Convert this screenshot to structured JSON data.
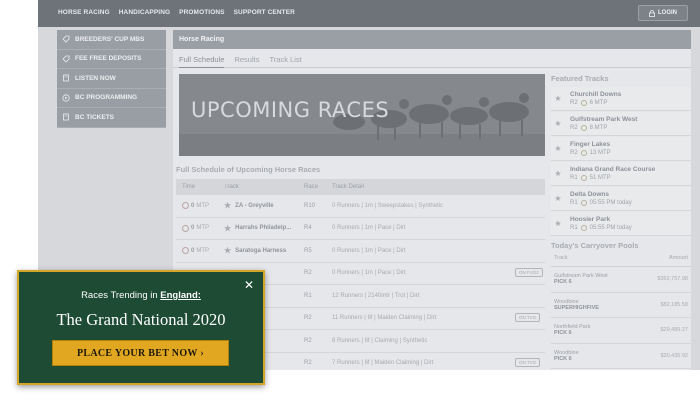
{
  "nav": {
    "links": [
      "HORSE RACING",
      "HANDICAPPING",
      "PROMOTIONS",
      "SUPPORT CENTER"
    ],
    "login_label": "LOGIN"
  },
  "sidebar": {
    "items": [
      {
        "label": "BREEDERS' CUP MBS",
        "icon": "tag-icon"
      },
      {
        "label": "FEE FREE DEPOSITS",
        "icon": "tag-icon"
      },
      {
        "label": "LISTEN NOW",
        "icon": "document-icon"
      },
      {
        "label": "BC PROGRAMMING",
        "icon": "play-icon"
      },
      {
        "label": "BC TICKETS",
        "icon": "document-icon"
      }
    ]
  },
  "main": {
    "title": "Horse Racing",
    "tabs": [
      "Full Schedule",
      "Results",
      "Track List"
    ],
    "banner_text": "UPCOMING RACES",
    "schedule_title": "Full Schedule of Upcoming Horse Races",
    "columns": [
      "Time",
      "Track",
      "Race",
      "Track Detail"
    ],
    "rows": [
      {
        "time": "0",
        "unit": "MTP",
        "track": "ZA - Greyville",
        "race": "R10",
        "detail": "0 Runners | 1m | Sweepstakes | Synthetic",
        "tvg": ""
      },
      {
        "time": "0",
        "unit": "MTP",
        "track": "Harrahs Philadelp...",
        "race": "R4",
        "detail": "0 Runners | 1m | Pace | Dirt",
        "tvg": ""
      },
      {
        "time": "0",
        "unit": "MTP",
        "track": "Saratoga Harness",
        "race": "R5",
        "detail": "0 Runners | 1m | Pace | Dirt",
        "tvg": ""
      },
      {
        "time": "",
        "unit": "",
        "track": "ows",
        "race": "R2",
        "detail": "0 Runners | 1m | Pace | Dirt",
        "tvg": "ON FVG2"
      },
      {
        "time": "",
        "unit": "",
        "track": "gsaker",
        "race": "R1",
        "detail": "12 Runners | 2140mtr | Trot | Dirt",
        "tvg": ""
      },
      {
        "time": "",
        "unit": "",
        "track": "ll Downs",
        "race": "R2",
        "detail": "11 Runners | 6f | Maiden Claiming | Dirt",
        "tvg": "ON TVG"
      },
      {
        "time": "",
        "unit": "",
        "track": "alk",
        "race": "R2",
        "detail": "8 Runners | 6f | Claiming | Synthetic",
        "tvg": ""
      },
      {
        "time": "",
        "unit": "",
        "track": "am Park ...",
        "race": "R2",
        "detail": "7 Runners | 6f | Maiden Claiming | Dirt",
        "tvg": "ON TVG"
      }
    ]
  },
  "featured": {
    "title": "Featured Tracks",
    "items": [
      {
        "name": "Churchill Downs",
        "race": "R2",
        "mtp": "6 MTP"
      },
      {
        "name": "Gulfstream Park West",
        "race": "R2",
        "mtp": "8 MTP"
      },
      {
        "name": "Finger Lakes",
        "race": "R2",
        "mtp": "13 MTP"
      },
      {
        "name": "Indiana Grand Race Course",
        "race": "R1",
        "mtp": "51 MTP"
      },
      {
        "name": "Delta Downs",
        "race": "R1",
        "mtp": "05:55 PM today"
      },
      {
        "name": "Hoosier Park",
        "race": "R1",
        "mtp": "05:55 PM today"
      }
    ]
  },
  "carryover": {
    "title": "Today's Carryover Pools",
    "col_track": "Track",
    "col_amount": "Amount",
    "rows": [
      {
        "track": "Gulfstream Park West",
        "pool": "PICK 6",
        "amount": "$362,757.98"
      },
      {
        "track": "Woodbine",
        "pool": "SUPERHIGHFIVE",
        "amount": "$82,185.58"
      },
      {
        "track": "Northfield Park",
        "pool": "PICK 6",
        "amount": "$29,489.27"
      },
      {
        "track": "Woodbine",
        "pool": "PICK 6",
        "amount": "$20,435.92"
      }
    ]
  },
  "popup": {
    "trend_prefix": "Races Trending in",
    "trend_place": "England:",
    "headline": "The Grand National 2020",
    "cta": "PLACE YOUR BET NOW ›",
    "close": "✕",
    "bg_color": "#1d4b34",
    "border_color": "#d3a62a",
    "cta_color": "#e2a720"
  }
}
